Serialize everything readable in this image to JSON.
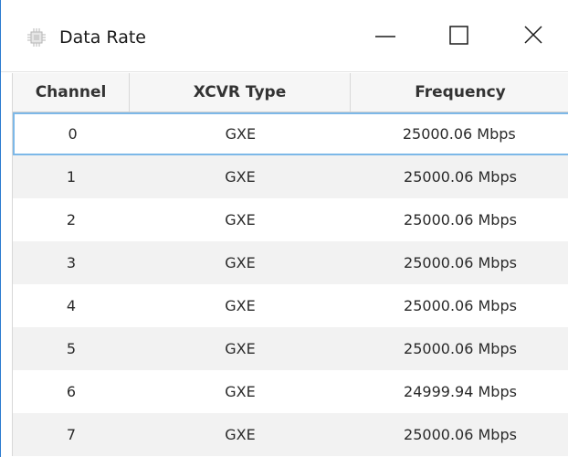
{
  "window": {
    "title": "Data Rate",
    "minimize_icon": "minimize-icon",
    "maximize_icon": "maximize-icon",
    "close_icon": "close-icon",
    "app_icon": "chip-icon"
  },
  "table": {
    "columns": [
      "Channel",
      "XCVR Type",
      "Frequency"
    ],
    "rows": [
      {
        "channel": "0",
        "type": "GXE",
        "frequency": "25000.06 Mbps"
      },
      {
        "channel": "1",
        "type": "GXE",
        "frequency": "25000.06 Mbps"
      },
      {
        "channel": "2",
        "type": "GXE",
        "frequency": "25000.06 Mbps"
      },
      {
        "channel": "3",
        "type": "GXE",
        "frequency": "25000.06 Mbps"
      },
      {
        "channel": "4",
        "type": "GXE",
        "frequency": "25000.06 Mbps"
      },
      {
        "channel": "5",
        "type": "GXE",
        "frequency": "25000.06 Mbps"
      },
      {
        "channel": "6",
        "type": "GXE",
        "frequency": "24999.94 Mbps"
      },
      {
        "channel": "7",
        "type": "GXE",
        "frequency": "25000.06 Mbps"
      }
    ],
    "selected_row": 0
  },
  "colors": {
    "selection_border": "#7db8e8",
    "stripe": "#f2f2f2",
    "window_border": "#2b7bd0"
  }
}
